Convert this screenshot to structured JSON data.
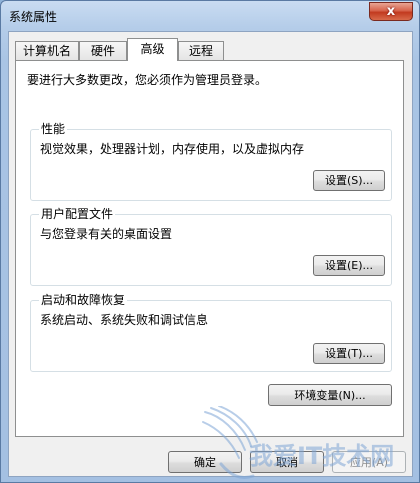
{
  "window": {
    "title": "系统属性",
    "close_glyph": "x"
  },
  "tabs": [
    {
      "label": "计算机名",
      "active": false
    },
    {
      "label": "硬件",
      "active": false
    },
    {
      "label": "高级",
      "active": true
    },
    {
      "label": "远程",
      "active": false
    }
  ],
  "advanced": {
    "admin_notice": "要进行大多数更改，您必须作为管理员登录。",
    "performance": {
      "title": "性能",
      "description": "视觉效果，处理器计划，内存使用，以及虚拟内存",
      "button": "设置(S)..."
    },
    "user_profiles": {
      "title": "用户配置文件",
      "description": "与您登录有关的桌面设置",
      "button": "设置(E)..."
    },
    "startup_recovery": {
      "title": "启动和故障恢复",
      "description": "系统启动、系统失败和调试信息",
      "button": "设置(T)..."
    },
    "env_button": "环境变量(N)..."
  },
  "dialog_buttons": {
    "ok": "确定",
    "cancel": "取消",
    "apply": "应用(A)"
  },
  "watermark": {
    "text": "我爱IT技术网"
  },
  "colors": {
    "title_bar": "#b5cde9",
    "close_button": "#c23a1f",
    "dialog_background": "#f0f0f0",
    "panel_background": "#ffffff",
    "watermark": "#7fa6d6"
  }
}
